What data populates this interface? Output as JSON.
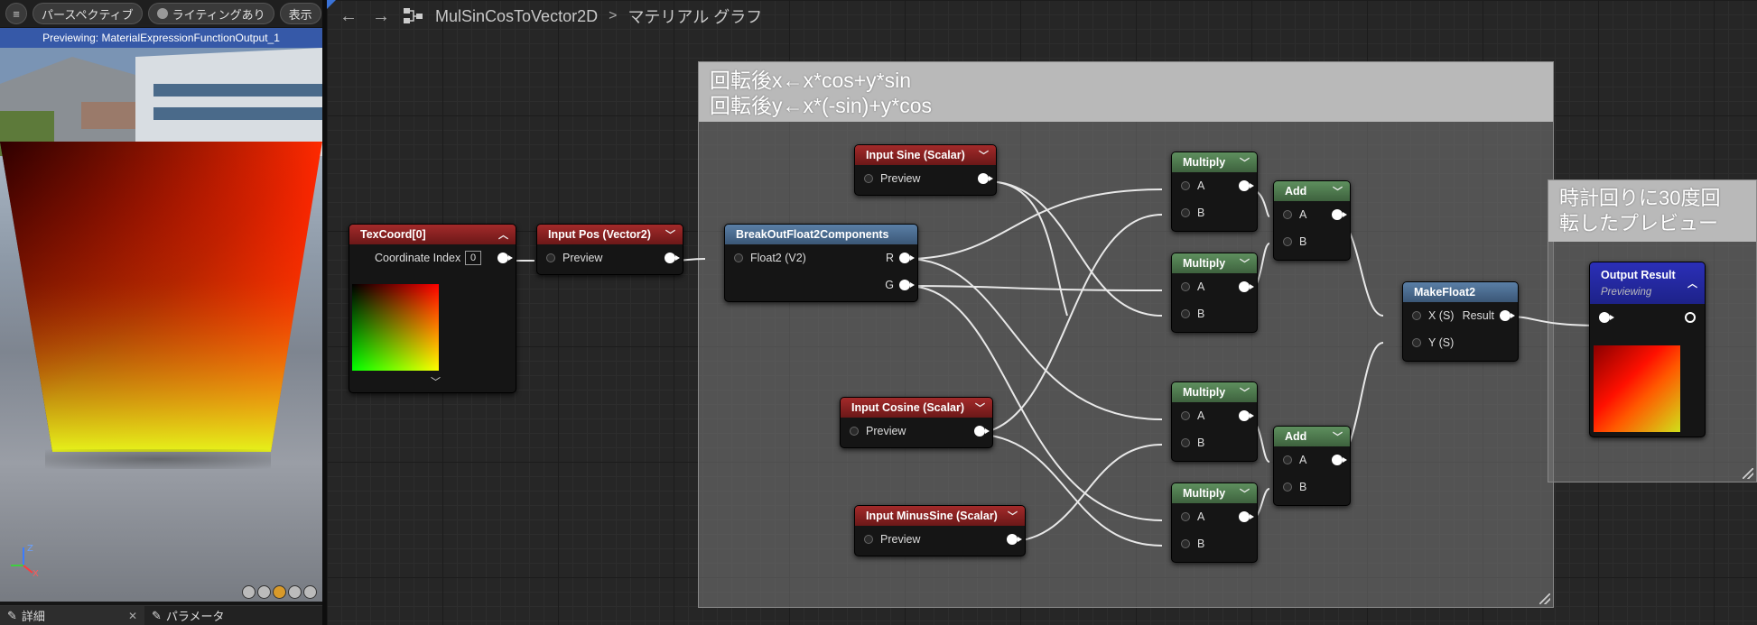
{
  "viewport_toolbar": {
    "menu_icon": "hamburger-icon",
    "perspective_label": "パースペクティブ",
    "lighting_label": "ライティングあり",
    "show_label": "表示"
  },
  "preview_banner": "Previewing: MaterialExpressionFunctionOutput_1",
  "axis": {
    "z": "Z",
    "x": "X"
  },
  "bottom_tabs": [
    {
      "label": "詳細",
      "icon": "pencil-icon",
      "close": "✕"
    },
    {
      "label": "パラメータ",
      "icon": "pencil-icon"
    }
  ],
  "graph_toolbar": {
    "back_icon": "←",
    "forward_icon": "→",
    "graph_icon": "graph-icon",
    "asset_name": "MulSinCosToVector2D",
    "separator": ">",
    "graph_name": "マテリアル グラフ"
  },
  "comments": {
    "main": {
      "line1": "回転後x←x*cos+y*sin",
      "line2": "回転後y←x*(-sin)+y*cos"
    },
    "preview": {
      "line1": "時計回りに30度回",
      "line2": "転したプレビュー"
    }
  },
  "nodes": {
    "texcoord": {
      "title": "TexCoord[0]",
      "prop_label": "Coordinate Index",
      "prop_value": "0"
    },
    "input_pos": {
      "title": "Input Pos (Vector2)",
      "pin": "Preview"
    },
    "break_out": {
      "title": "BreakOutFloat2Components",
      "in_pin": "Float2 (V2)",
      "out_r": "R",
      "out_g": "G"
    },
    "input_sine": {
      "title": "Input Sine (Scalar)",
      "pin": "Preview"
    },
    "input_cosine": {
      "title": "Input Cosine (Scalar)",
      "pin": "Preview"
    },
    "input_minus_sine": {
      "title": "Input MinusSine (Scalar)",
      "pin": "Preview"
    },
    "multiply_1": {
      "title": "Multiply",
      "a": "A",
      "b": "B"
    },
    "multiply_2": {
      "title": "Multiply",
      "a": "A",
      "b": "B"
    },
    "multiply_3": {
      "title": "Multiply",
      "a": "A",
      "b": "B"
    },
    "multiply_4": {
      "title": "Multiply",
      "a": "A",
      "b": "B"
    },
    "add_1": {
      "title": "Add",
      "a": "A",
      "b": "B"
    },
    "add_2": {
      "title": "Add",
      "a": "A",
      "b": "B"
    },
    "make_float2": {
      "title": "MakeFloat2",
      "x": "X (S)",
      "y": "Y (S)",
      "out": "Result"
    },
    "output_result": {
      "title": "Output Result",
      "subtitle": "Previewing"
    }
  },
  "colors": {
    "red_header": "#a32a2a",
    "green_header": "#5e8f5e",
    "blue_header": "#5a7fa6",
    "navy_header": "#2b2fb8",
    "preview_banner": "#3659a8",
    "accent_orange": "#d89a2a"
  }
}
